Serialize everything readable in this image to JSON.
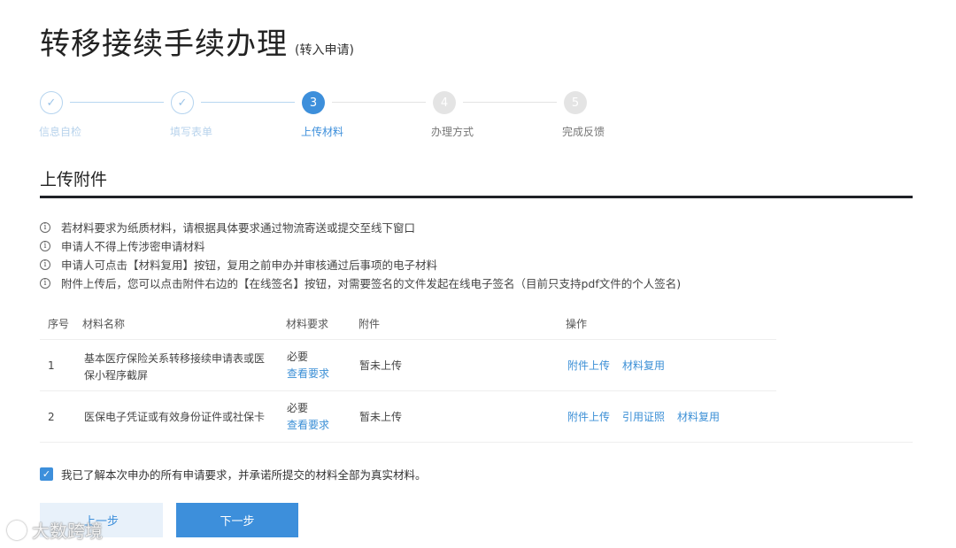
{
  "header": {
    "title": "转移接续手续办理",
    "subtitle": "(转入申请)"
  },
  "steps": [
    {
      "label": "信息自检",
      "state": "done",
      "marker": "✓"
    },
    {
      "label": "填写表单",
      "state": "done",
      "marker": "✓"
    },
    {
      "label": "上传材料",
      "state": "active",
      "marker": "3"
    },
    {
      "label": "办理方式",
      "state": "todo",
      "marker": "4"
    },
    {
      "label": "完成反馈",
      "state": "todo",
      "marker": "5"
    }
  ],
  "section": {
    "title": "上传附件"
  },
  "notices": [
    "若材料要求为纸质材料，请根据具体要求通过物流寄送或提交至线下窗口",
    "申请人不得上传涉密申请材料",
    "申请人可点击【材料复用】按钮，复用之前申办并审核通过后事项的电子材料",
    "附件上传后，您可以点击附件右边的【在线签名】按钮，对需要签名的文件发起在线电子签名（目前只支持pdf文件的个人签名)"
  ],
  "table": {
    "headers": {
      "index": "序号",
      "name": "材料名称",
      "requirement": "材料要求",
      "attachment": "附件",
      "operations": "操作"
    },
    "rows": [
      {
        "index": "1",
        "name": "基本医疗保险关系转移接续申请表或医保小程序截屏",
        "requirement": "必要",
        "view_link": "查看要求",
        "attachment": "暂未上传",
        "ops": [
          "附件上传",
          "材料复用"
        ]
      },
      {
        "index": "2",
        "name": "医保电子凭证或有效身份证件或社保卡",
        "requirement": "必要",
        "view_link": "查看要求",
        "attachment": "暂未上传",
        "ops": [
          "附件上传",
          "引用证照",
          "材料复用"
        ]
      }
    ]
  },
  "agreement": {
    "checked": true,
    "text": "我已了解本次申办的所有申请要求，并承诺所提交的材料全部为真实材料。"
  },
  "buttons": {
    "prev": "上一步",
    "next": "下一步"
  },
  "watermark": {
    "text": "大数跨境"
  },
  "colors": {
    "accent": "#3d8fdb",
    "rule": "#1f2126"
  }
}
